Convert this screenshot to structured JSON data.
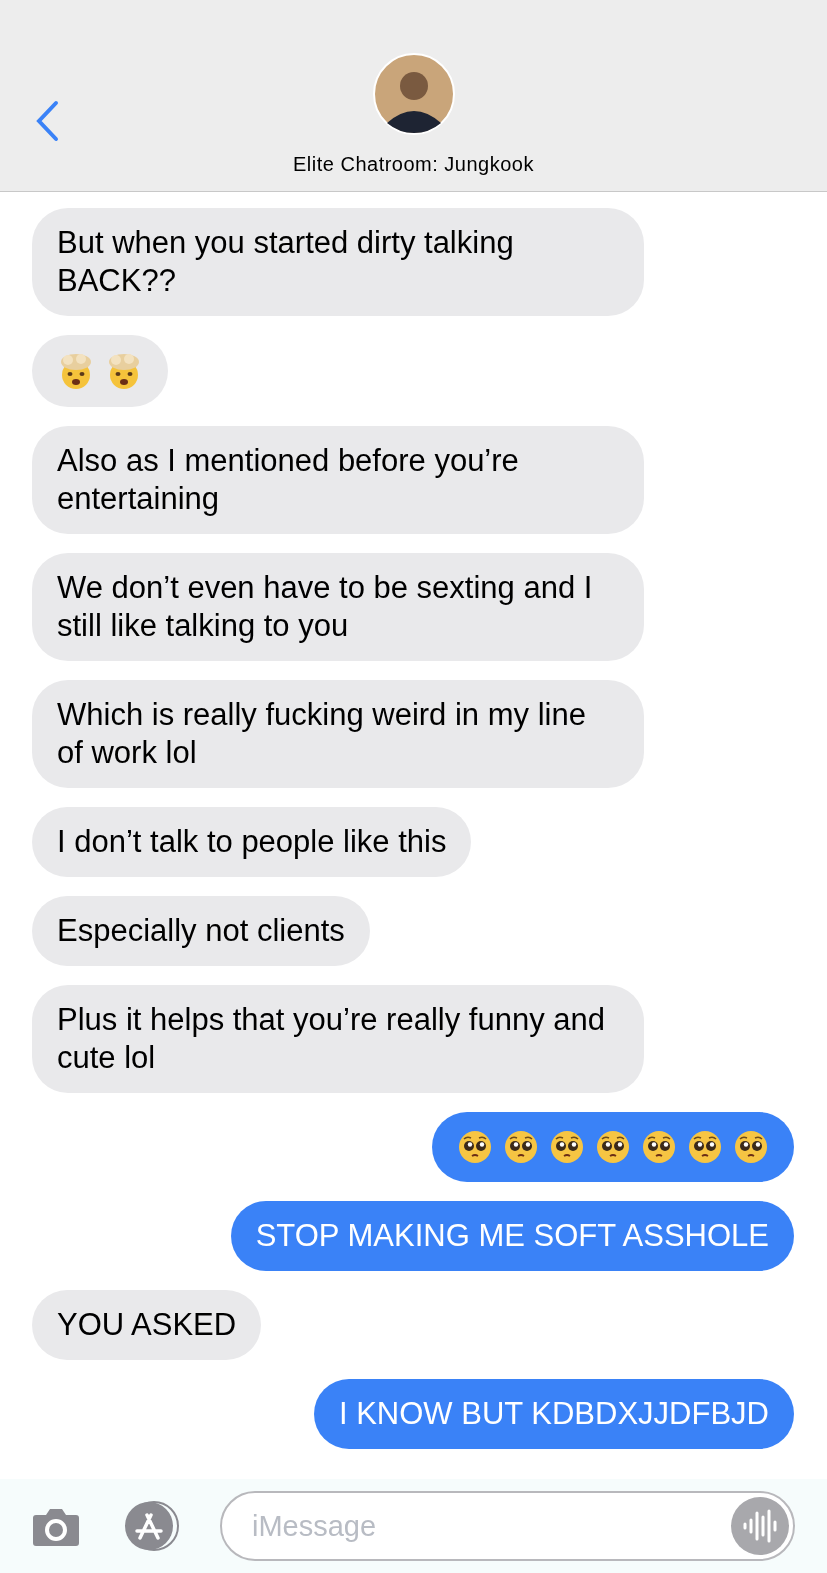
{
  "header": {
    "title": "Elite Chatroom: Jungkook"
  },
  "messages": [
    {
      "sent": false,
      "kind": "text",
      "text": "But when you started dirty talking BACK??"
    },
    {
      "sent": false,
      "kind": "emoji",
      "emojis": [
        {
          "kind": "exploding-head"
        },
        {
          "kind": "exploding-head"
        }
      ]
    },
    {
      "sent": false,
      "kind": "text",
      "text": "Also as I mentioned before you’re entertaining"
    },
    {
      "sent": false,
      "kind": "text",
      "text": "We don’t even have to be sexting and I still like talking to you"
    },
    {
      "sent": false,
      "kind": "text",
      "text": "Which is really fucking weird in my line of work lol"
    },
    {
      "sent": false,
      "kind": "text",
      "text": "I don’t talk to people like this"
    },
    {
      "sent": false,
      "kind": "text",
      "text": "Especially not clients"
    },
    {
      "sent": false,
      "kind": "text",
      "text": "Plus it helps that you’re really funny and cute lol"
    },
    {
      "sent": true,
      "kind": "emoji",
      "emojis": [
        {
          "kind": "pleading-face"
        },
        {
          "kind": "pleading-face"
        },
        {
          "kind": "pleading-face"
        },
        {
          "kind": "pleading-face"
        },
        {
          "kind": "pleading-face"
        },
        {
          "kind": "pleading-face"
        },
        {
          "kind": "pleading-face"
        }
      ]
    },
    {
      "sent": true,
      "kind": "text",
      "text": "STOP MAKING ME SOFT ASSHOLE"
    },
    {
      "sent": false,
      "kind": "text",
      "text": "YOU ASKED"
    },
    {
      "sent": true,
      "kind": "text",
      "text": "I KNOW BUT KDBDXJJDFBJD"
    }
  ],
  "composer": {
    "placeholder": "iMessage"
  }
}
